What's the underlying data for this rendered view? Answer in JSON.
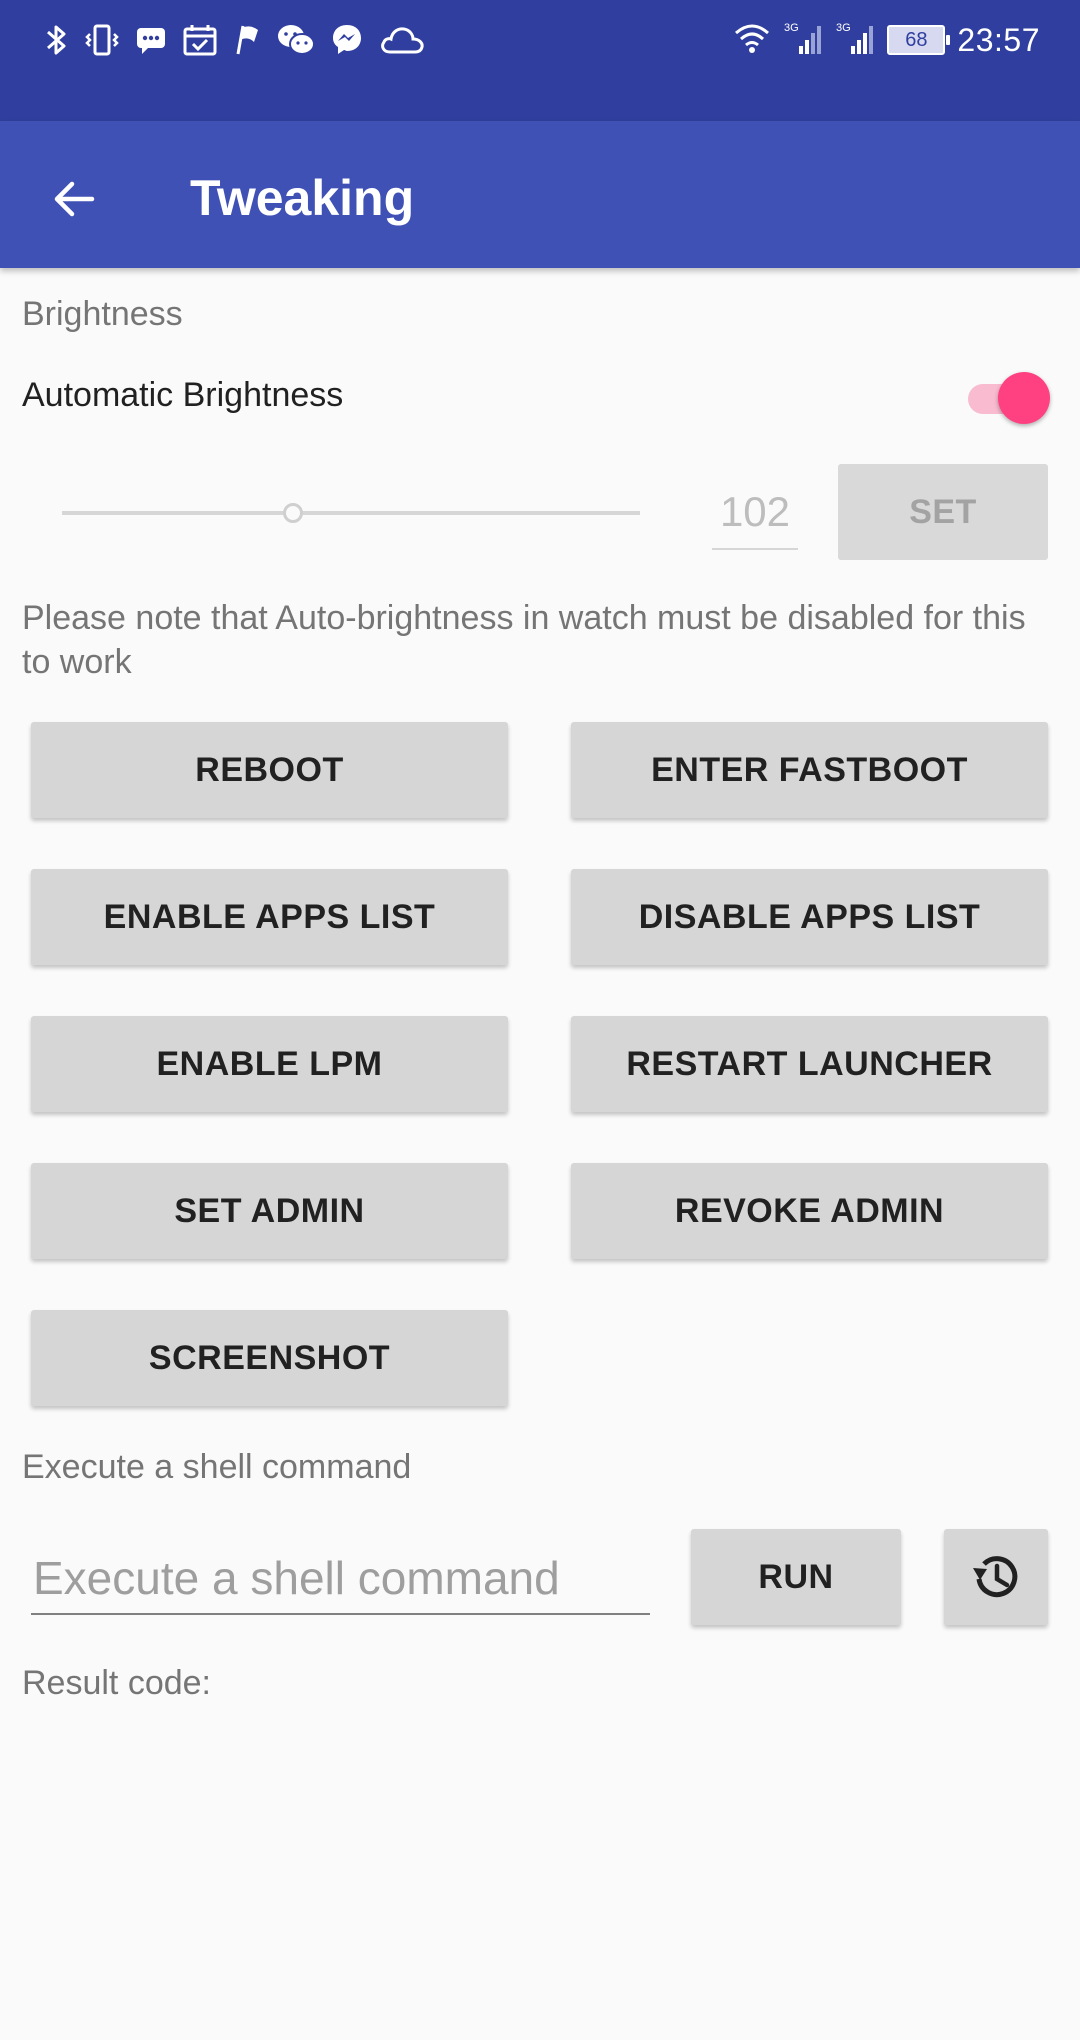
{
  "status_bar": {
    "battery": "68",
    "time": "23:57",
    "network_1": "3G",
    "network_2": "3G",
    "icons_left": [
      "bluetooth-icon",
      "vibrate-icon",
      "message-icon",
      "calendar-icon",
      "flag-icon",
      "wechat-icon",
      "messenger-icon",
      "cloud-icon"
    ],
    "icons_right": [
      "wifi-icon",
      "signal-icon",
      "signal-icon",
      "battery-icon"
    ],
    "color": "#303f9f"
  },
  "app_bar": {
    "title": "Tweaking",
    "color": "#3f51b5"
  },
  "brightness": {
    "section_label": "Brightness",
    "auto_label": "Automatic Brightness",
    "auto_enabled": true,
    "slider_value": 102,
    "slider_max": 255,
    "value_text": "102",
    "set_button": "SET",
    "note": "Please note that Auto-brightness in watch must be disabled for this to work"
  },
  "actions": {
    "reboot": "REBOOT",
    "enter_fastboot": "ENTER FASTBOOT",
    "enable_apps_list": "ENABLE APPS LIST",
    "disable_apps_list": "DISABLE APPS LIST",
    "enable_lpm": "ENABLE LPM",
    "restart_launcher": "RESTART LAUNCHER",
    "set_admin": "SET ADMIN",
    "revoke_admin": "REVOKE ADMIN",
    "screenshot": "SCREENSHOT"
  },
  "shell": {
    "section_label": "Execute a shell command",
    "input_placeholder": "Execute a shell command",
    "input_value": "",
    "run_button": "RUN",
    "history_icon": "history-icon",
    "result_label": "Result code:"
  },
  "colors": {
    "accent": "#ff4081",
    "accent_light": "#f8bbd0",
    "button_bg": "#d6d6d6"
  }
}
